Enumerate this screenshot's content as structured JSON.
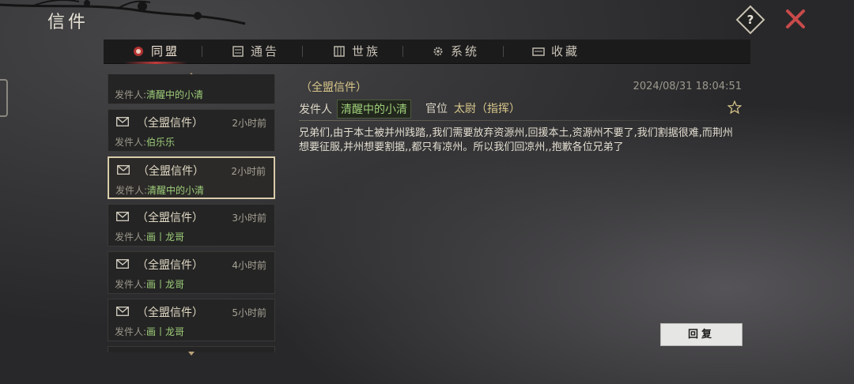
{
  "window": {
    "title": "信件"
  },
  "tabs": [
    {
      "label": "同盟",
      "active": true
    },
    {
      "label": "通告",
      "active": false
    },
    {
      "label": "世族",
      "active": false
    },
    {
      "label": "系统",
      "active": false
    },
    {
      "label": "收藏",
      "active": false
    }
  ],
  "mail_list": {
    "sender_prefix": "发件人:",
    "partial_top": {
      "sender": "清醒中的小清"
    },
    "items": [
      {
        "subject": "（全盟信件）",
        "time": "2小时前",
        "sender": "伯乐乐",
        "selected": false
      },
      {
        "subject": "（全盟信件）",
        "time": "2小时前",
        "sender": "清醒中的小清",
        "selected": true
      },
      {
        "subject": "（全盟信件）",
        "time": "3小时前",
        "sender": "画丨龙哥",
        "selected": false
      },
      {
        "subject": "（全盟信件）",
        "time": "4小时前",
        "sender": "画丨龙哥",
        "selected": false
      },
      {
        "subject": "（全盟信件）",
        "time": "5小时前",
        "sender": "画丨龙哥",
        "selected": false
      }
    ]
  },
  "detail": {
    "subject": "（全盟信件）",
    "date": "2024/08/31 18:04:51",
    "from_label": "发件人",
    "from_name": "清醒中的小清",
    "rank_label": "官位",
    "rank_value": "太尉（指挥）",
    "body": "兄弟们,由于本土被并州践踏,,我们需要放弃资源州,回援本土,资源州不要了,我们割据很难,而荆州想要征服,并州想要割据,,都只有凉州。所以我们回凉州,,抱歉各位兄弟了"
  },
  "reply_label": "回复",
  "colors": {
    "accent_red": "#c23b3b",
    "sender_green": "#9fcf7a",
    "gold_text": "#d8c68a"
  },
  "icons": [
    "help-icon",
    "close-icon",
    "alliance-icon",
    "notice-icon",
    "clan-icon",
    "system-gear-icon",
    "favorites-icon",
    "envelope-icon",
    "star-icon"
  ]
}
